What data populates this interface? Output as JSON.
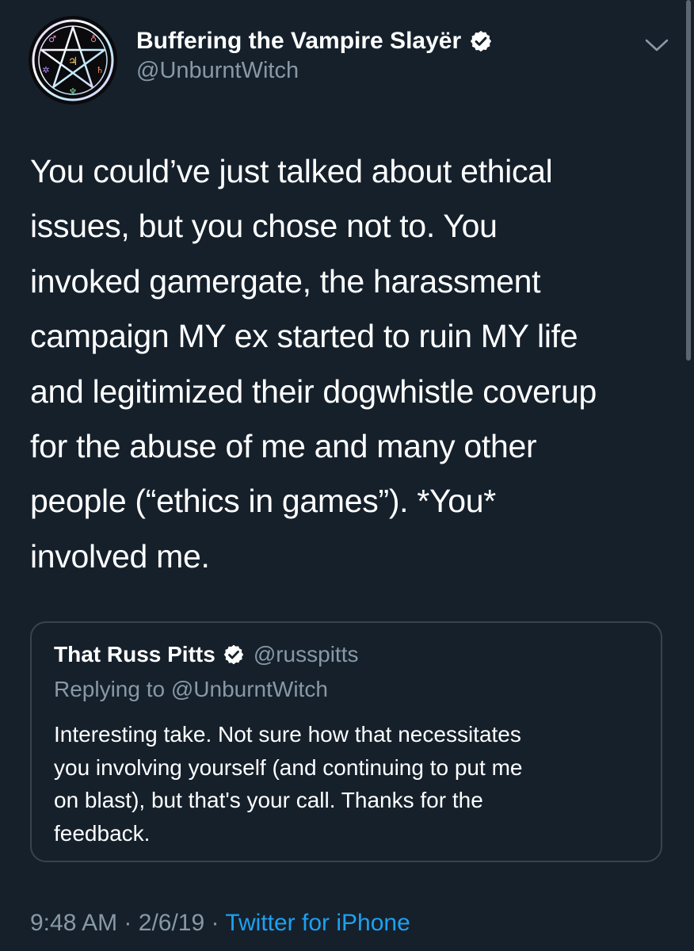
{
  "author": {
    "display_name": "Buffering the Vampire Slayër",
    "handle": "@UnburntWitch",
    "verified": true,
    "avatar_icon": "pentagram-avatar-icon"
  },
  "tweet": {
    "text": "You could’ve just talked about ethical\nissues, but you chose not to. You\ninvoked gamergate, the harassment\ncampaign MY ex started to ruin MY life\nand legitimized their dogwhistle coverup\nfor the abuse of me and many other\npeople (“ethics in games”). *You*\ninvolved me.",
    "time": "9:48 AM",
    "separator": "·",
    "date": "2/6/19",
    "source": "Twitter for iPhone"
  },
  "quoted_tweet": {
    "display_name": "That Russ Pitts",
    "handle": "@russpitts",
    "verified": true,
    "replying_to": "Replying to @UnburntWitch",
    "text": "Interesting take. Not sure how that necessitates\nyou involving yourself (and continuing to put me\non blast), but that's your call. Thanks for the\nfeedback."
  },
  "icons": {
    "verified": "verified-badge-icon",
    "menu": "chevron-down-icon"
  },
  "colors": {
    "background": "#15202b",
    "primary_text": "#ffffff",
    "secondary_text": "#8899a6",
    "link": "#1da1f2",
    "card_border": "#38444d"
  }
}
